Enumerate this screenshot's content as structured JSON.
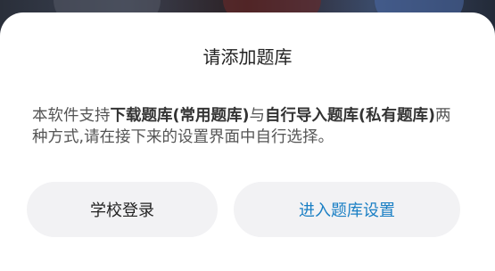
{
  "dialog": {
    "title": "请添加题库",
    "message": {
      "p1": "本软件支持",
      "b1": "下载题库(常用题库)",
      "p2": "与",
      "b2": "自行导入题库(私有题库)",
      "p3": "两种方式,请在接下来的设置界面中自行选择。"
    },
    "buttons": {
      "school_login": "学校登录",
      "bank_settings": "进入题库设置"
    }
  },
  "colors": {
    "accent": "#1a7fc4",
    "button_bg": "#f2f2f4",
    "dialog_bg": "#ffffff"
  }
}
